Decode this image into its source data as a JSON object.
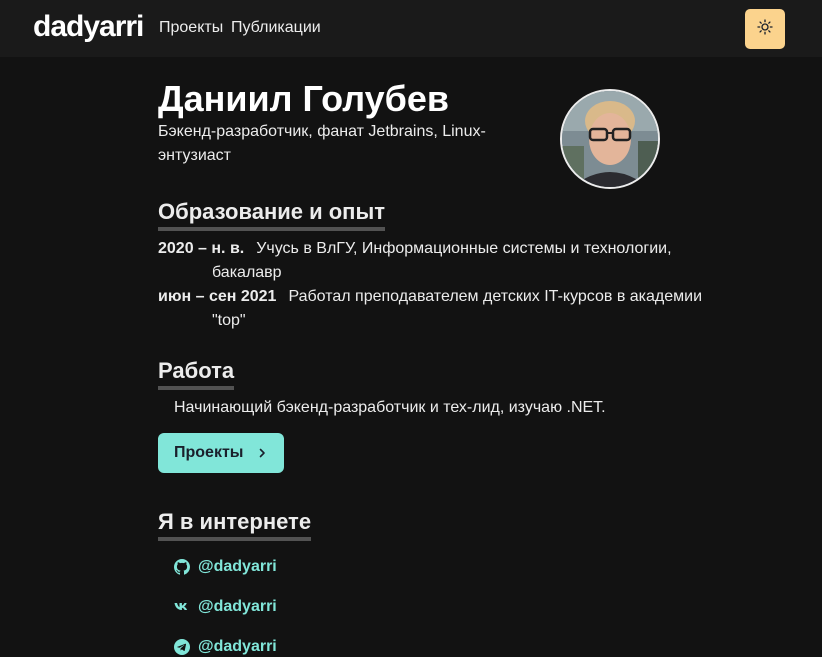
{
  "navbar": {
    "logo": "dadyarri",
    "links": [
      "Проекты",
      "Публикации"
    ],
    "theme_toggle_color": "#fbd38d"
  },
  "profile": {
    "name": "Даниил Голубев",
    "tagline": "Бэкенд-разработчик, фанат Jetbrains, Linux-энтузиаст"
  },
  "education": {
    "heading": "Образование и опыт",
    "items": [
      {
        "period": "2020 – н. в.",
        "text": "Учусь в ВлГУ, Информационные системы и технологии, бакалавр"
      },
      {
        "period": "июн – сен 2021",
        "text": "Работал преподавателем детских IT-курсов в академии \"top\""
      }
    ]
  },
  "work": {
    "heading": "Работа",
    "text": "Начинающий бэкенд-разработчик и тех-лид, изучаю .NET.",
    "button_label": "Проекты"
  },
  "online": {
    "heading": "Я в интернете",
    "links": [
      {
        "icon": "github-icon",
        "label": "@dadyarri"
      },
      {
        "icon": "vk-icon",
        "label": "@dadyarri"
      },
      {
        "icon": "telegram-icon",
        "label": "@dadyarri"
      }
    ]
  },
  "colors": {
    "background": "#121212",
    "navbar": "#1a1a1a",
    "accent": "#81e6d9",
    "heading_underline": "#525252"
  }
}
